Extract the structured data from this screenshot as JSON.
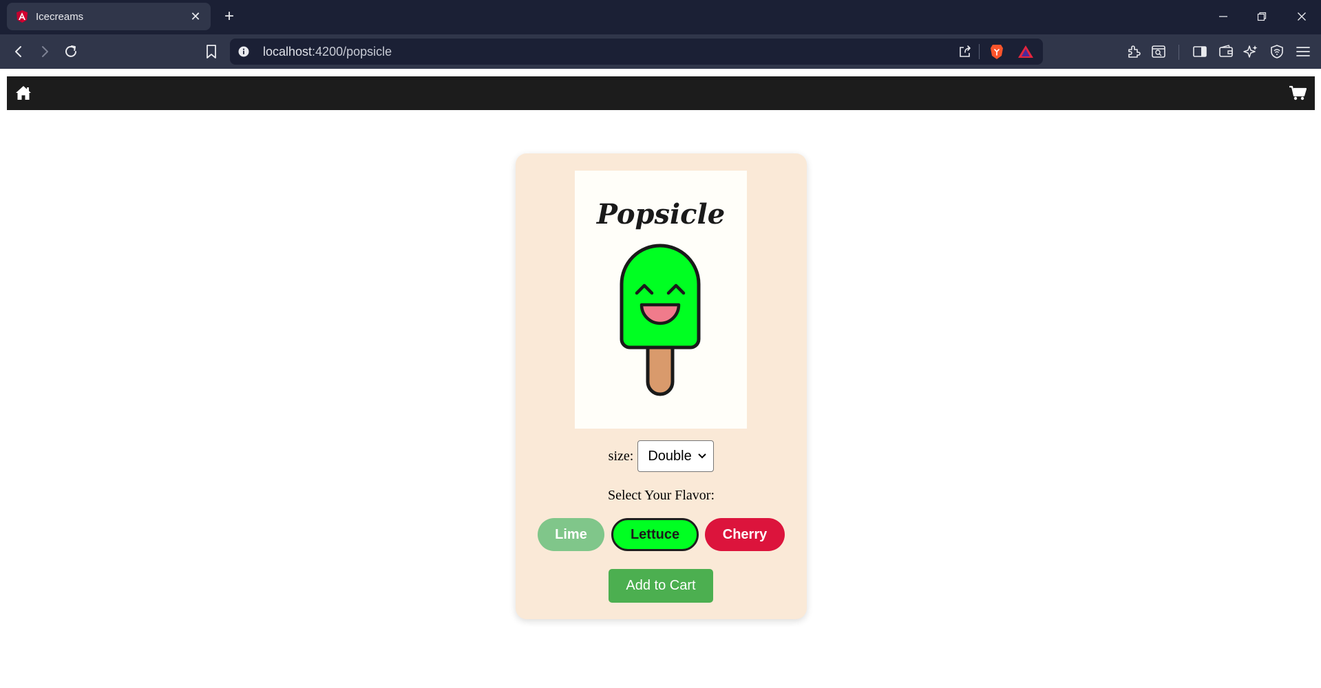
{
  "browser": {
    "tab_title": "Icecreams",
    "tab_close": "✕",
    "new_tab": "+",
    "url_host": "localhost",
    "url_path": ":4200/popsicle"
  },
  "product": {
    "title": "Popsicle",
    "size_label": "size:",
    "size_selected": "Double",
    "flavor_prompt": "Select Your Flavor:",
    "flavors": [
      {
        "label": "Lime",
        "color": "#80c68a",
        "selected": false
      },
      {
        "label": "Lettuce",
        "color": "#00ff22",
        "selected": true
      },
      {
        "label": "Cherry",
        "color": "#dc143c",
        "selected": false
      }
    ],
    "add_to_cart": "Add to Cart"
  },
  "colors": {
    "navbar": "#1c1c1c",
    "card": "#fae9d7",
    "popsicle_body": "#00ff22",
    "popsicle_stick": "#d99a6c",
    "tongue": "#f07b8b",
    "add_to_cart": "#4caf50"
  },
  "icons": {
    "nav_left": "home-icon",
    "nav_right": "cart-icon"
  }
}
